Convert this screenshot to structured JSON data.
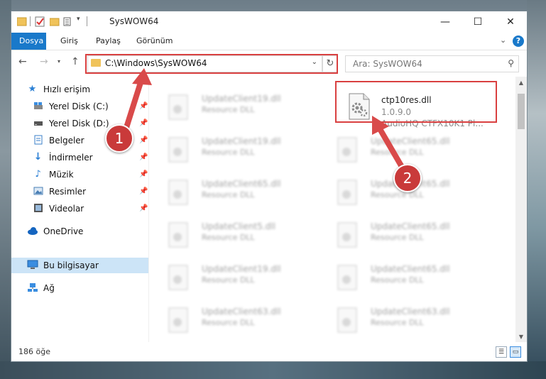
{
  "window": {
    "title": "SysWOW64",
    "controls": {
      "minimize": "—",
      "maximize": "☐",
      "close": "✕"
    }
  },
  "ribbon": {
    "tabs": [
      {
        "label": "Dosya",
        "active": true
      },
      {
        "label": "Giriş",
        "active": false
      },
      {
        "label": "Paylaş",
        "active": false
      },
      {
        "label": "Görünüm",
        "active": false
      }
    ],
    "help": "?"
  },
  "address": {
    "path": "C:\\Windows\\SysWOW64",
    "search_placeholder": "Ara: SysWOW64"
  },
  "sidebar": {
    "items": [
      {
        "label": "Hızlı erişim",
        "icon": "star-icon",
        "pinned": false
      },
      {
        "label": "Yerel Disk (C:)",
        "icon": "drive-icon",
        "pinned": true
      },
      {
        "label": "Yerel Disk (D:)",
        "icon": "drive-icon",
        "pinned": true
      },
      {
        "label": "Belgeler",
        "icon": "documents-icon",
        "pinned": true
      },
      {
        "label": "İndirmeler",
        "icon": "download-icon",
        "pinned": true
      },
      {
        "label": "Müzik",
        "icon": "music-icon",
        "pinned": true
      },
      {
        "label": "Resimler",
        "icon": "pictures-icon",
        "pinned": true
      },
      {
        "label": "Videolar",
        "icon": "videos-icon",
        "pinned": true
      },
      {
        "label": "OneDrive",
        "icon": "cloud-icon",
        "pinned": false
      },
      {
        "label": "Bu bilgisayar",
        "icon": "computer-icon",
        "pinned": false
      },
      {
        "label": "Ağ",
        "icon": "network-icon",
        "pinned": false
      }
    ]
  },
  "files": {
    "target": {
      "name": "ctp10res.dll",
      "version": "1.0.9.0",
      "description": "AudioHQ CTFX10K1 Pl..."
    },
    "left_column": [
      {
        "name": "UpdateClient19.dll",
        "type": "Resource DLL"
      },
      {
        "name": "UpdateClient19.dll",
        "type": "Resource DLL"
      },
      {
        "name": "UpdateClient65.dll",
        "type": "Resource DLL"
      },
      {
        "name": "UpdateClient5.dll",
        "type": "Resource DLL"
      },
      {
        "name": "UpdateClient19.dll",
        "type": "Resource DLL"
      },
      {
        "name": "UpdateClient63.dll",
        "type": "Resource DLL"
      }
    ],
    "right_column": [
      {
        "name": "UpdateClient65.dll",
        "type": "Resource DLL"
      },
      {
        "name": "UpdateClient65.dll",
        "type": "Resource DLL"
      },
      {
        "name": "UpdateClient65.dll",
        "type": "Resource DLL"
      },
      {
        "name": "UpdateClient65.dll",
        "type": "Resource DLL"
      },
      {
        "name": "UpdateClient63.dll",
        "type": "Resource DLL"
      }
    ]
  },
  "status": {
    "item_count": "186 öğe"
  },
  "callouts": {
    "one": "1",
    "two": "2"
  },
  "colors": {
    "accent": "#1979ca",
    "highlight": "#d94040",
    "callout": "#c93a3a"
  }
}
